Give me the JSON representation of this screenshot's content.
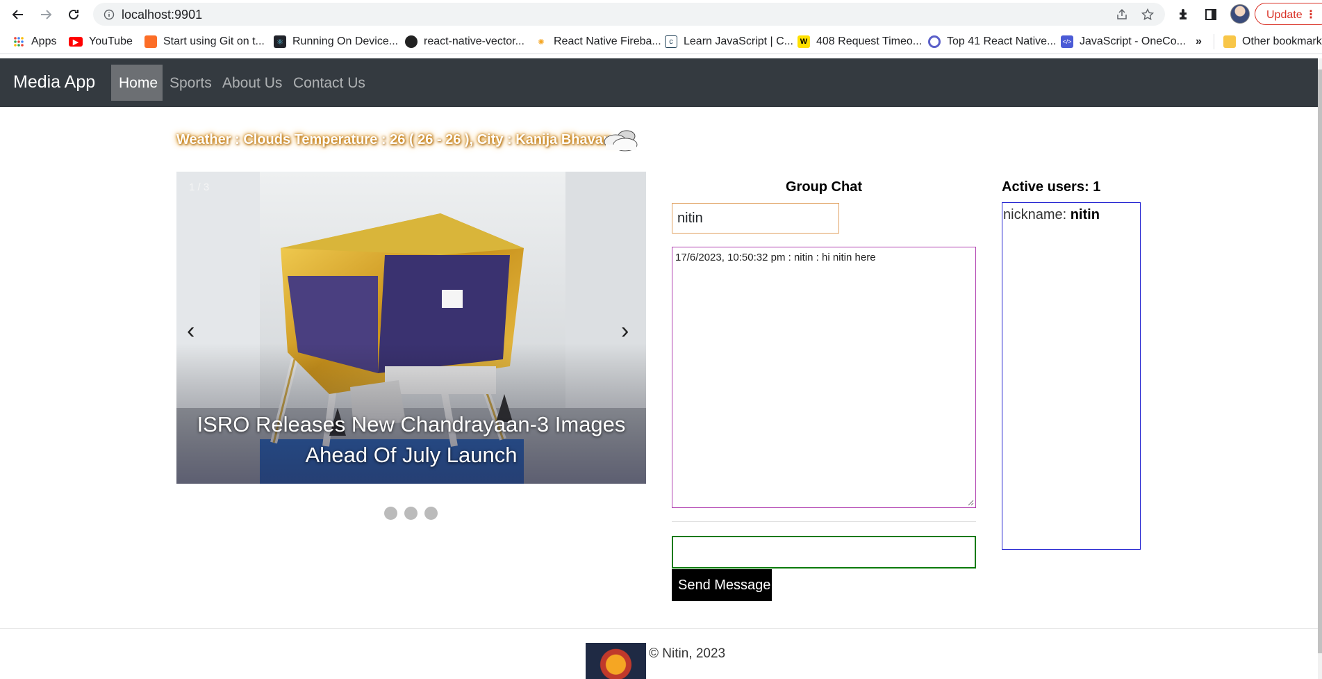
{
  "browser": {
    "url": "localhost:9901",
    "update_label": "Update",
    "bookmarks": [
      {
        "label": "Apps",
        "icon": "apps-grid-icon"
      },
      {
        "label": "YouTube",
        "icon": "youtube-icon"
      },
      {
        "label": "Start using Git on t...",
        "icon": "gitlab-icon"
      },
      {
        "label": "Running On Device...",
        "icon": "react-icon"
      },
      {
        "label": "react-native-vector...",
        "icon": "github-icon"
      },
      {
        "label": "React Native Fireba...",
        "icon": "firebase-icon"
      },
      {
        "label": "Learn JavaScript | C...",
        "icon": "codecademy-icon"
      },
      {
        "label": "408 Request Timeo...",
        "icon": "w-icon"
      },
      {
        "label": "Top 41 React Native...",
        "icon": "circle-icon"
      },
      {
        "label": "JavaScript - OneCo...",
        "icon": "code-icon"
      }
    ],
    "more_label": "»",
    "other_bookmarks": "Other bookmarks"
  },
  "navbar": {
    "brand": "Media App",
    "links": [
      "Home",
      "Sports",
      "About Us",
      "Contact Us"
    ],
    "active": "Home"
  },
  "weather": {
    "text": "Weather : Clouds Temperature : 26 ( 26 - 26 ), City : Kanija Bhavan,",
    "icon": "cloud-icon"
  },
  "carousel": {
    "counter": "1 / 3",
    "caption_line1": "ISRO Releases New Chandrayaan-3 Images",
    "caption_line2": "Ahead Of July Launch",
    "prev": "‹",
    "next": "›",
    "slide_count": 3
  },
  "chat": {
    "title": "Group Chat",
    "nickname_value": "nitin",
    "messages": [
      "17/6/2023, 10:50:32 pm : nitin : hi nitin here"
    ],
    "message_value": "",
    "send_label": "Send Message"
  },
  "active_users": {
    "label": "Active users:",
    "count": "1",
    "nick_label": "nickname:",
    "users": [
      "nitin"
    ]
  },
  "footer": {
    "text": "© Nitin, 2023"
  },
  "colors": {
    "navbar_bg": "#343a40",
    "chat_border": "#b03fb0",
    "nick_border": "#e0a060",
    "msg_border": "#0a7a0a",
    "users_border": "#2020d0"
  }
}
